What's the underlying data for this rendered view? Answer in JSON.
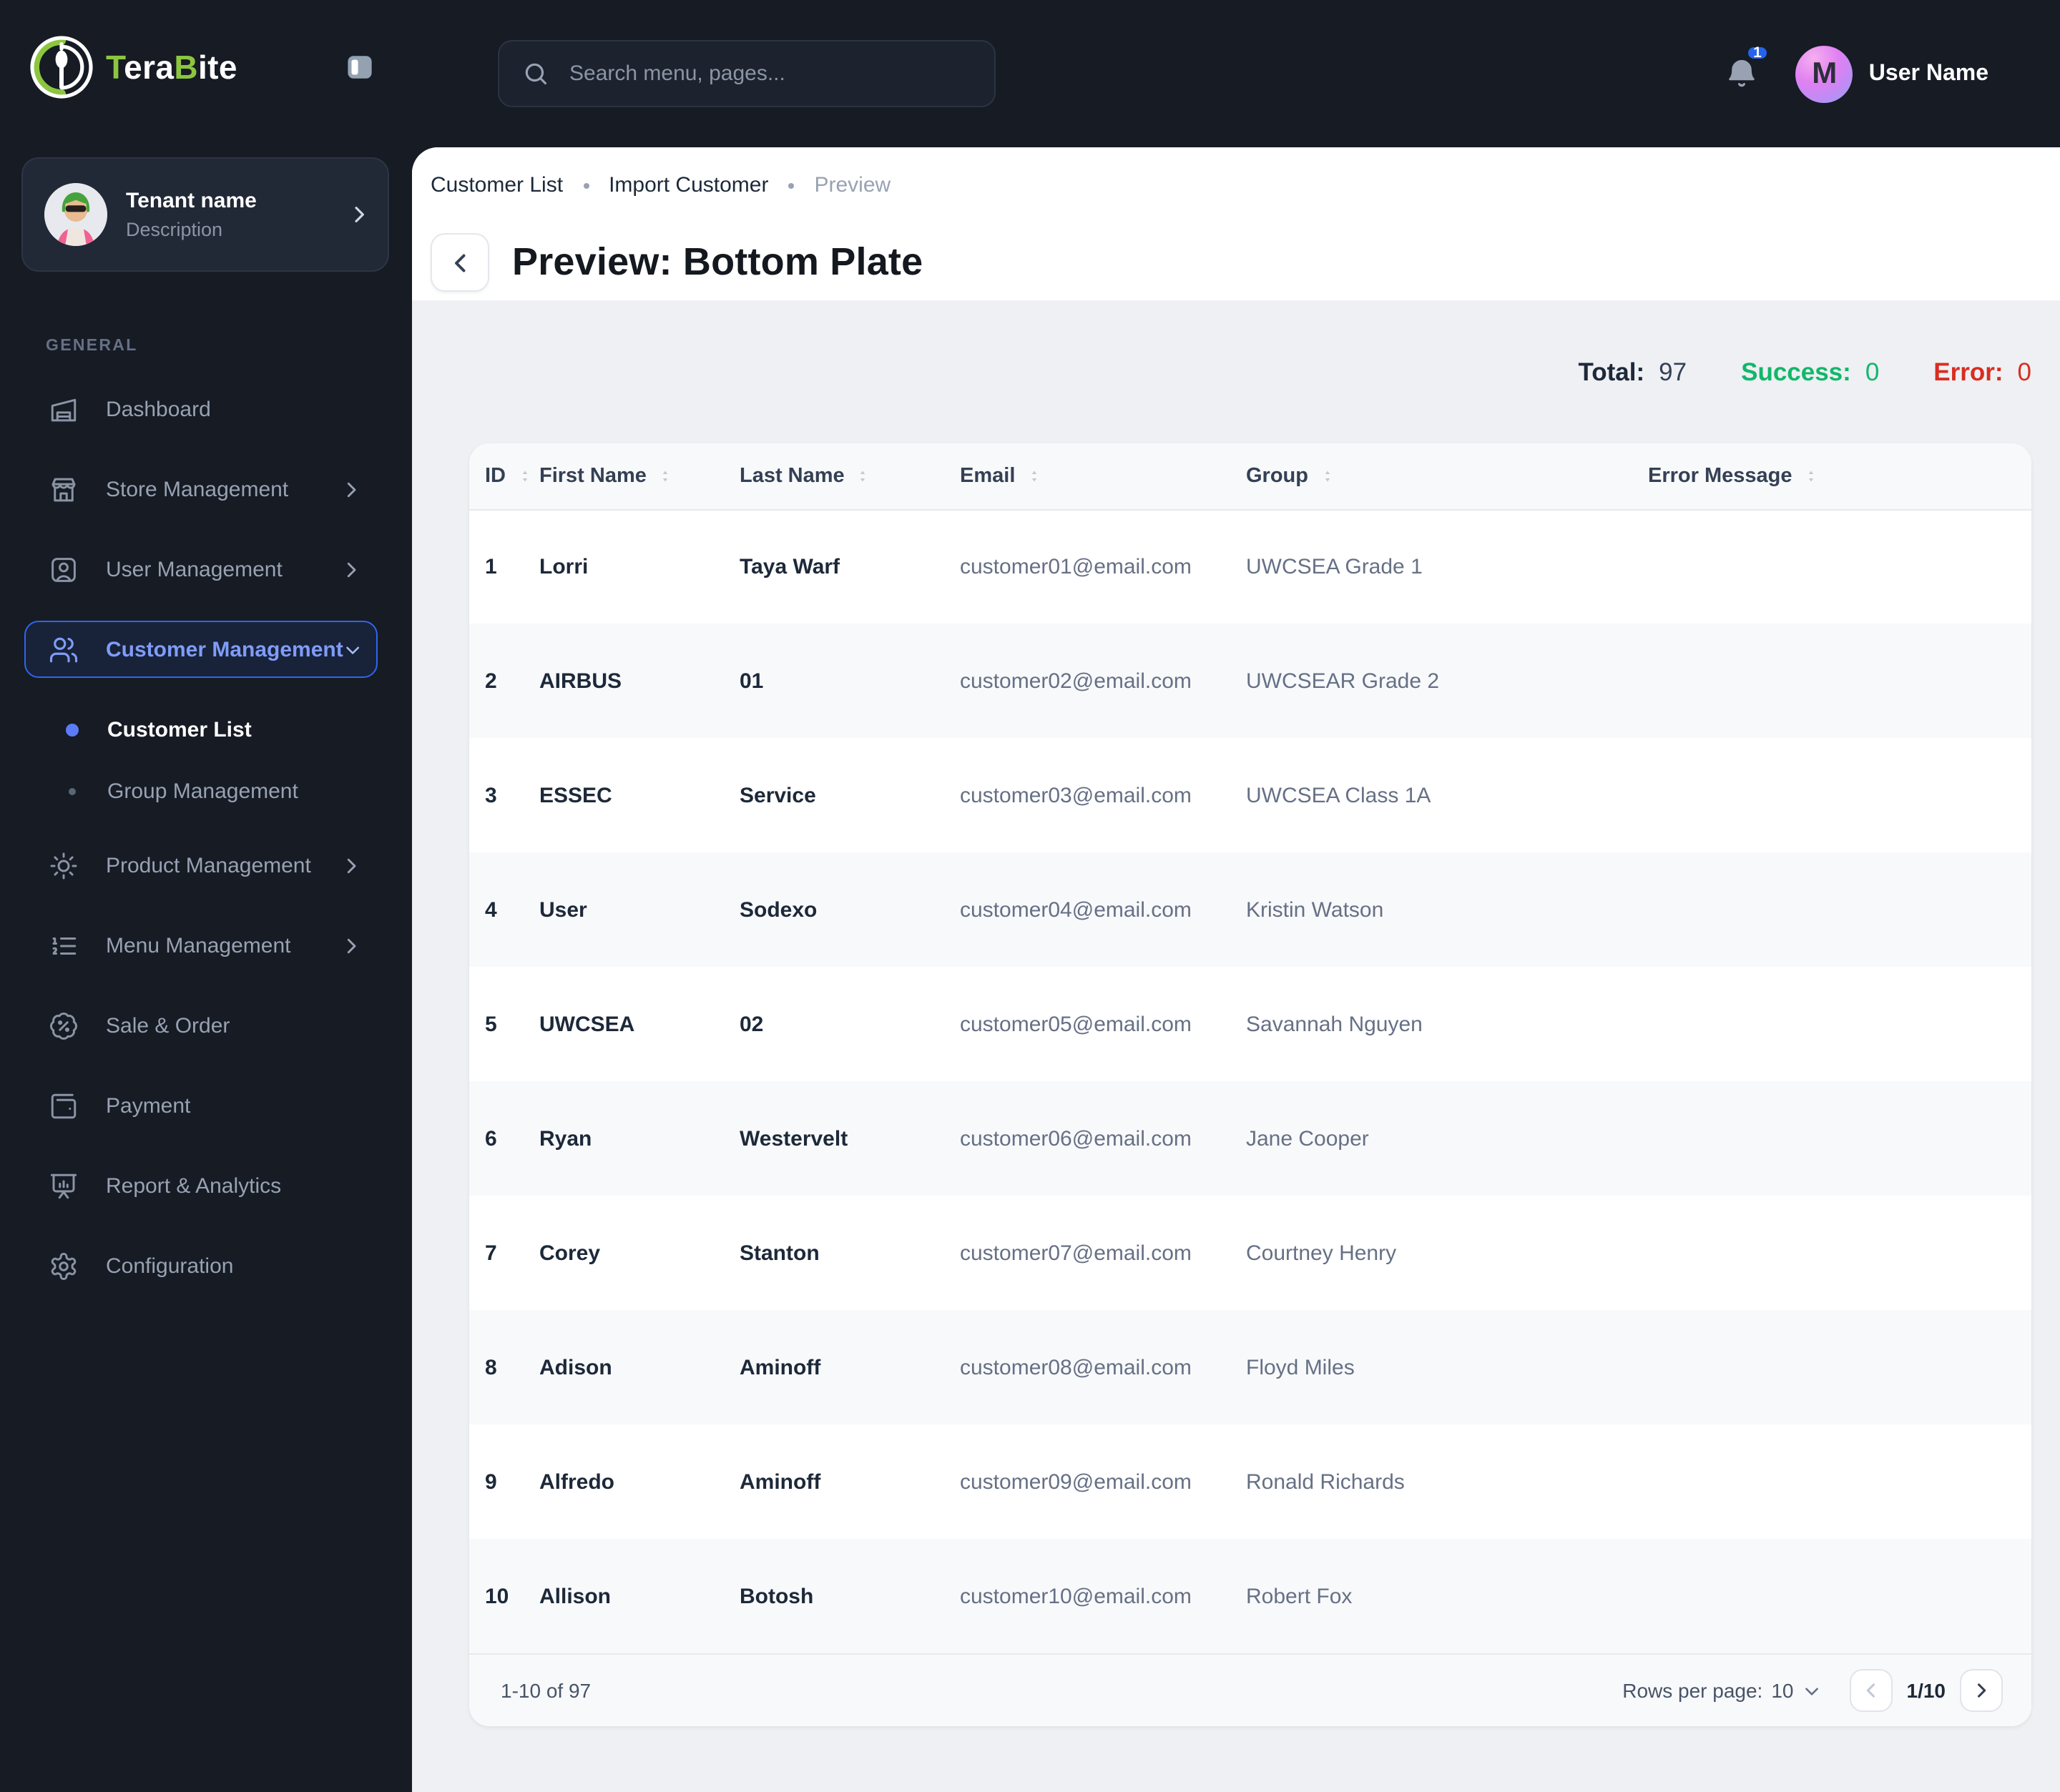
{
  "brand": {
    "part1": "T",
    "part2": "era",
    "part3": "B",
    "part4": "ite"
  },
  "sidebar": {
    "tenant": {
      "name": "Tenant name",
      "description": "Description"
    },
    "section_label": "GENERAL",
    "items": [
      {
        "label": "Dashboard",
        "icon": "warehouse-icon"
      },
      {
        "label": "Store Management",
        "icon": "store-icon",
        "has_children": true
      },
      {
        "label": "User Management",
        "icon": "user-square-icon",
        "has_children": true
      },
      {
        "label": "Customer Management",
        "icon": "users-icon",
        "active": true,
        "expanded": true,
        "children": [
          {
            "label": "Customer List",
            "active": true
          },
          {
            "label": "Group Management",
            "active": false
          }
        ]
      },
      {
        "label": "Product Management",
        "icon": "cog-icon",
        "has_children": true
      },
      {
        "label": "Menu Management",
        "icon": "list-ordered-icon",
        "has_children": true
      },
      {
        "label": "Sale & Order",
        "icon": "badge-percent-icon"
      },
      {
        "label": "Payment",
        "icon": "wallet-icon"
      },
      {
        "label": "Report & Analytics",
        "icon": "presentation-icon"
      },
      {
        "label": "Configuration",
        "icon": "settings-icon"
      }
    ]
  },
  "topbar": {
    "search_placeholder": "Search menu, pages...",
    "notification_count": "1",
    "user": {
      "initial": "M",
      "name": "User Name"
    }
  },
  "page": {
    "breadcrumb": [
      {
        "label": "Customer List"
      },
      {
        "label": "Import Customer"
      },
      {
        "label": "Preview",
        "current": true
      }
    ],
    "title": "Preview: Bottom Plate",
    "stats": {
      "total_label": "Total:",
      "total": "97",
      "success_label": "Success:",
      "success": "0",
      "error_label": "Error:",
      "error": "0"
    }
  },
  "table": {
    "columns": [
      "ID",
      "First Name",
      "Last Name",
      "Email",
      "Group",
      "Error Message"
    ],
    "rows": [
      {
        "id": "1",
        "first_name": "Lorri",
        "last_name": "Taya Warf",
        "email": "customer01@email.com",
        "group": "UWCSEA Grade 1",
        "error_message": ""
      },
      {
        "id": "2",
        "first_name": "AIRBUS",
        "last_name": "01",
        "email": "customer02@email.com",
        "group": "UWCSEAR Grade 2",
        "error_message": ""
      },
      {
        "id": "3",
        "first_name": "ESSEC",
        "last_name": "Service",
        "email": "customer03@email.com",
        "group": "UWCSEA Class 1A",
        "error_message": ""
      },
      {
        "id": "4",
        "first_name": "User",
        "last_name": "Sodexo",
        "email": "customer04@email.com",
        "group": "Kristin Watson",
        "error_message": ""
      },
      {
        "id": "5",
        "first_name": "UWCSEA",
        "last_name": "02",
        "email": "customer05@email.com",
        "group": "Savannah Nguyen",
        "error_message": ""
      },
      {
        "id": "6",
        "first_name": "Ryan",
        "last_name": "Westervelt",
        "email": "customer06@email.com",
        "group": "Jane Cooper",
        "error_message": ""
      },
      {
        "id": "7",
        "first_name": "Corey",
        "last_name": "Stanton",
        "email": "customer07@email.com",
        "group": "Courtney Henry",
        "error_message": ""
      },
      {
        "id": "8",
        "first_name": "Adison",
        "last_name": "Aminoff",
        "email": "customer08@email.com",
        "group": "Floyd Miles",
        "error_message": ""
      },
      {
        "id": "9",
        "first_name": "Alfredo",
        "last_name": "Aminoff",
        "email": "customer09@email.com",
        "group": "Ronald Richards",
        "error_message": ""
      },
      {
        "id": "10",
        "first_name": "Allison",
        "last_name": "Botosh",
        "email": "customer10@email.com",
        "group": "Robert Fox",
        "error_message": ""
      }
    ],
    "footer": {
      "range": "1-10 of 97",
      "rows_per_page_label": "Rows per page:",
      "rows_per_page": "10",
      "page_indicator": "1/10"
    }
  },
  "colors": {
    "sidebar_bg": "#161b24",
    "accent_blue": "#2f66f0",
    "active_text_blue": "#7f9cf9",
    "brand_green": "#8CC63F",
    "success_green": "#12b76a",
    "error_red": "#d92d20",
    "badge_blue": "#2563eb",
    "page_bg": "#eef0f3",
    "stripe_gray": "#f8f9fb"
  }
}
